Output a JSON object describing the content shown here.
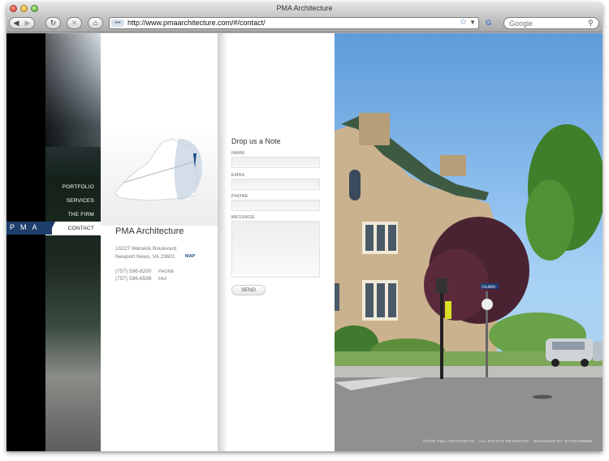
{
  "browser": {
    "window_title": "PMA Architecture",
    "url": "http://www.pmaarchitecture.com/#/contact/",
    "search_placeholder": "Google",
    "site_icon": "•••",
    "search_engine_badge": "G"
  },
  "site": {
    "logo": "PMA",
    "nav": [
      {
        "label": "PORTFOLIO",
        "active": false
      },
      {
        "label": "SERVICES",
        "active": false
      },
      {
        "label": "THE FIRM",
        "active": false
      },
      {
        "label": "CONTACT",
        "active": true
      }
    ],
    "company": "PMA Architecture",
    "address_line1": "10227 Warwick Boulevard",
    "address_line2": "Newport News, VA 23601",
    "map_link": "MAP",
    "phone": {
      "number": "(757) 596-8200",
      "label": "PHONE"
    },
    "fax": {
      "number": "(757) 596-6598",
      "label": "FAX"
    },
    "form": {
      "title": "Drop us a Note",
      "name_label": "NAME",
      "email_label": "EMAIL",
      "phone_label": "PHONE",
      "message_label": "MESSAGE",
      "send_label": "SEND"
    },
    "footer": "©2009 PMA ARCHITECTS · ALL RIGHTS RESERVED · DESIGNED BY STUDIO88988",
    "street_sign": "CALIBAR"
  },
  "colors": {
    "accent": "#1e3e6b",
    "link": "#1e4d86"
  }
}
